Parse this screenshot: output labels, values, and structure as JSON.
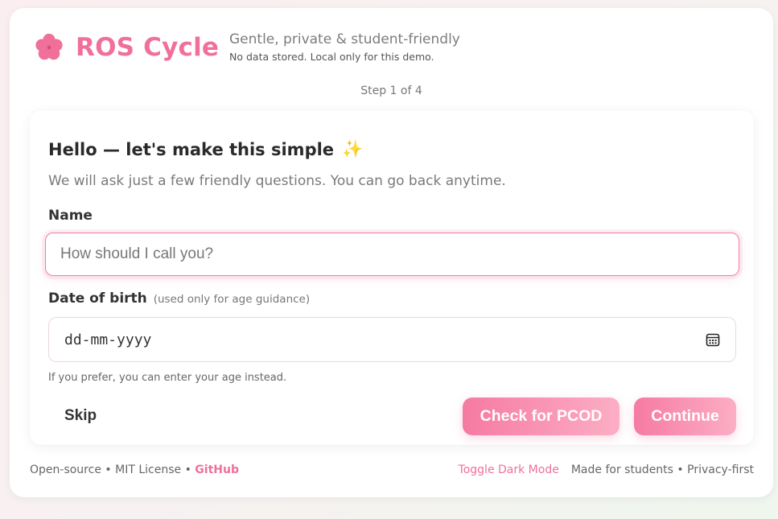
{
  "brand": {
    "title": "ROS Cycle",
    "tagline": "Gentle, private & student-friendly",
    "subtagline": "No data stored. Local only for this demo.",
    "accent_color": "#f0709a",
    "logo_icon": "flower-icon"
  },
  "progress": {
    "label": "Step 1 of 4",
    "current_step": 1,
    "total_steps": 4
  },
  "form": {
    "heading": "Hello — let's make this simple",
    "heading_icon": "sparkle-icon",
    "heading_emoji": "✨",
    "intro": "We will ask just a few friendly questions. You can go back anytime.",
    "name_label": "Name",
    "name_placeholder": "How should I call you?",
    "name_value": "",
    "dob_label": "Date of birth",
    "dob_hint": "(used only for age guidance)",
    "dob_placeholder": "dd-mm-yyyy",
    "dob_icon": "calendar-icon",
    "dob_note": "If you prefer, you can enter your age instead."
  },
  "actions": {
    "skip": "Skip",
    "check_pcod": "Check for PCOD",
    "continue": "Continue"
  },
  "footer": {
    "opensource": "Open-source",
    "license": "MIT License",
    "github": "GitHub",
    "separator": "•",
    "dark_mode": "Toggle Dark Mode",
    "made_for": "Made for students",
    "privacy": "Privacy-first"
  }
}
